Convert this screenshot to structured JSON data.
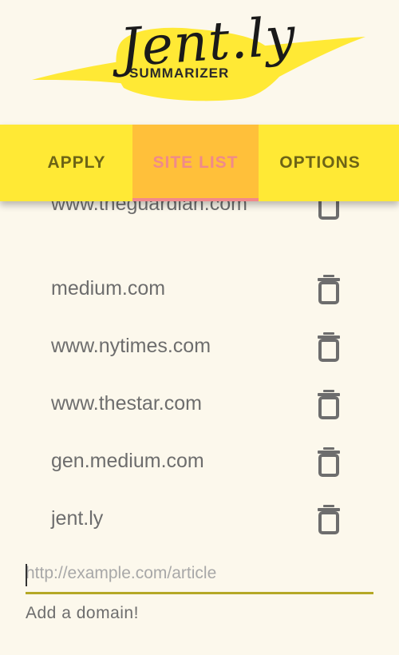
{
  "logo": {
    "script_text": "Jent.ly",
    "subtitle": "SUMMARIZER"
  },
  "tabs": [
    {
      "label": "APPLY",
      "active": false
    },
    {
      "label": "SITE LIST",
      "active": true
    },
    {
      "label": "OPTIONS",
      "active": false
    }
  ],
  "sites": [
    {
      "domain": "www.theguardian.com",
      "icon": "trash-icon"
    },
    {
      "domain": "medium.com",
      "icon": "trash-icon"
    },
    {
      "domain": "www.nytimes.com",
      "icon": "trash-icon"
    },
    {
      "domain": "www.thestar.com",
      "icon": "trash-icon"
    },
    {
      "domain": "gen.medium.com",
      "icon": "trash-icon"
    },
    {
      "domain": "jent.ly",
      "icon": "trash-icon"
    }
  ],
  "add_domain": {
    "placeholder": "http://example.com/article",
    "value": "",
    "helper_text": "Add a domain!"
  },
  "colors": {
    "background": "#fcf8ec",
    "tabbar": "#ffe935",
    "active_tab": "#ffc03a",
    "active_tab_text": "#f08a8a",
    "tab_text": "#6d6416",
    "input_underline": "#b5a826"
  }
}
